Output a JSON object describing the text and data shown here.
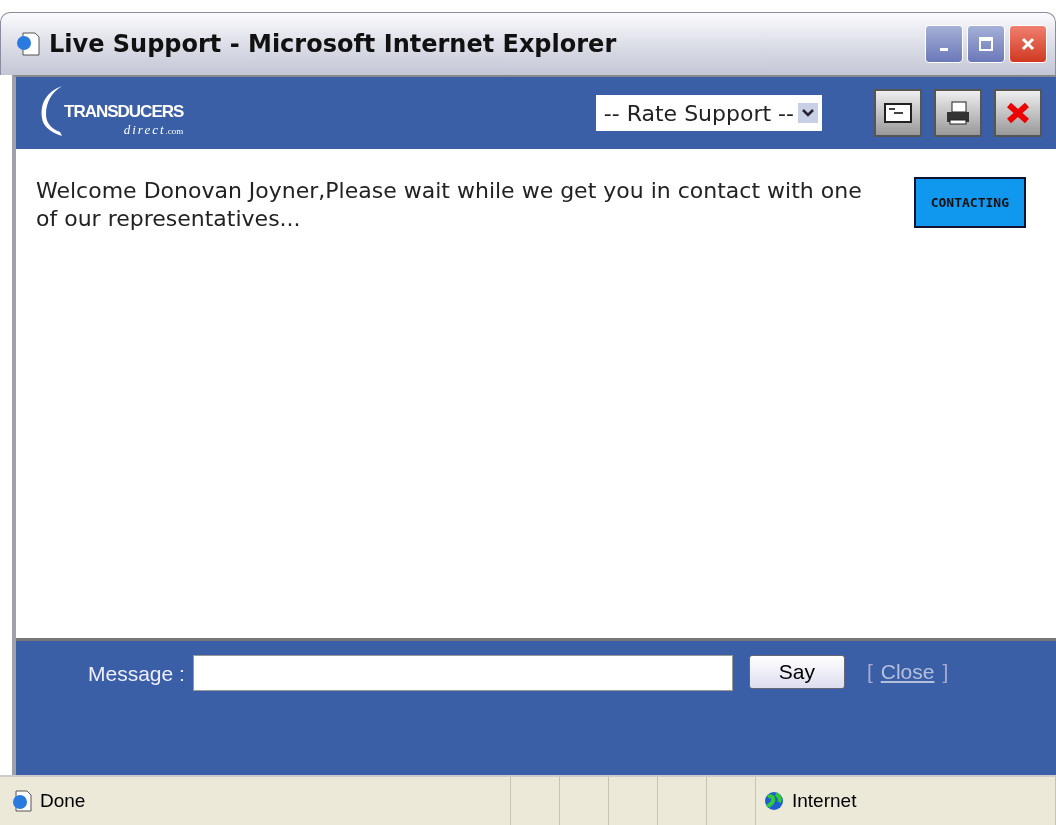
{
  "window": {
    "title": "Live Support - Microsoft Internet Explorer"
  },
  "header": {
    "logo_main": "TRANSDUCERS",
    "logo_sub": "direct",
    "logo_suffix": ".com",
    "rating_select": "-- Rate Support --"
  },
  "chat": {
    "message": "Welcome Donovan Joyner,Please wait while we get you in contact with one of our representatives...",
    "status_badge": "CONTACTING"
  },
  "composer": {
    "label": "Message :",
    "say_button": "Say",
    "bracket_open": "[",
    "close_link": "Close",
    "bracket_close": "]"
  },
  "status_bar": {
    "text": "Done",
    "zone": "Internet"
  }
}
